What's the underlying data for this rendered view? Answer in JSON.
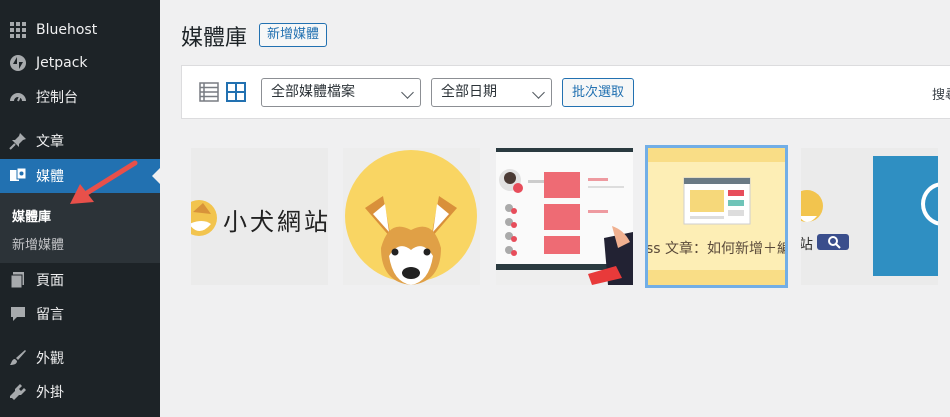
{
  "sidebar": {
    "items": [
      {
        "label": "Bluehost",
        "icon": "grid-icon"
      },
      {
        "label": "Jetpack",
        "icon": "jetpack-icon"
      },
      {
        "label": "控制台",
        "icon": "dashboard-icon"
      },
      {
        "label": "文章",
        "icon": "pin-icon"
      },
      {
        "label": "媒體",
        "icon": "media-icon"
      },
      {
        "label": "頁面",
        "icon": "page-icon"
      },
      {
        "label": "留言",
        "icon": "comment-icon"
      },
      {
        "label": "外觀",
        "icon": "brush-icon"
      },
      {
        "label": "外掛",
        "icon": "plugin-icon"
      }
    ],
    "submenu": [
      {
        "label": "媒體庫"
      },
      {
        "label": "新增媒體"
      }
    ],
    "active_color": "#2271b1"
  },
  "header": {
    "title": "媒體庫",
    "add_new_label": "新增媒體"
  },
  "toolbar": {
    "filter_type": "全部媒體檔案",
    "filter_date": "全部日期",
    "bulk_select_label": "批次選取",
    "search_label": "搜尋"
  },
  "media": {
    "thumbs": [
      {
        "text": "小犬網站"
      },
      {
        "text": ""
      },
      {
        "text": ""
      },
      {
        "text": "ss 文章：如何新增＋編"
      },
      {
        "text": "站"
      }
    ]
  },
  "annotation": {
    "arrow_color": "#e8504a"
  }
}
